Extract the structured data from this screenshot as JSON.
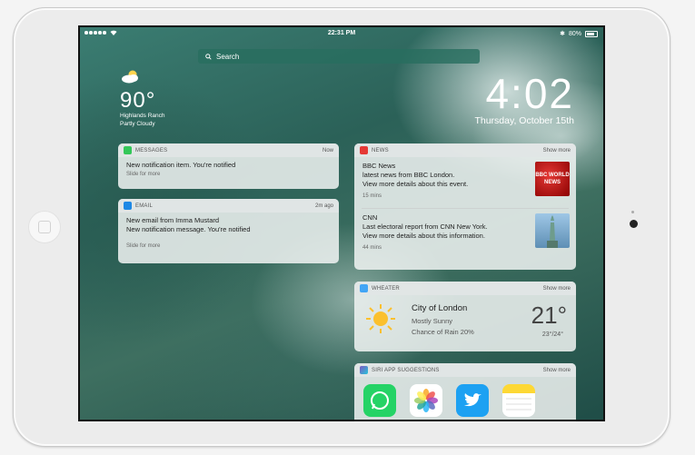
{
  "status": {
    "time": "22:31 PM",
    "battery": "80%"
  },
  "search": {
    "label": "Search"
  },
  "weather_widget": {
    "temp": "90°",
    "location": "Highlands Ranch",
    "condition": "Partly Cloudy"
  },
  "clock": {
    "time": "4:02",
    "date": "Thursday, October 15th"
  },
  "messages": {
    "app": "MESSAGES",
    "time": "Now",
    "text": "New notification item. You're notified",
    "hint": "Slide for more"
  },
  "email": {
    "app": "EMAIL",
    "time": "2m ago",
    "title": "New email from Imma Mustard",
    "text": "New notification message. You're notified",
    "hint": "Slide for more"
  },
  "news": {
    "app": "NEWS",
    "more": "Show more",
    "items": [
      {
        "source": "BBC News",
        "line1": "latest news from BBC London.",
        "line2": "View more details about this event.",
        "time": "15 mins",
        "thumb_text": "BBC WORLD NEWS"
      },
      {
        "source": "CNN",
        "line1": "Last electoral report from CNN New York.",
        "line2": "View more details about this information.",
        "time": "44 mins"
      }
    ]
  },
  "weather_card": {
    "app": "WHEATER",
    "more": "Show more",
    "city": "City of London",
    "condition": "Mostly Sunny",
    "rain": "Chance of Rain 20%",
    "temp": "21°",
    "range": "23°/24°"
  },
  "siri": {
    "app": "SIRI APP SUGGESTIONS",
    "more": "Show more"
  },
  "colors": {
    "accent": "#1f6f5f",
    "messages": "#34c759",
    "email": "#1e88e5",
    "news": "#e53935",
    "weather": "#42a5f5"
  }
}
